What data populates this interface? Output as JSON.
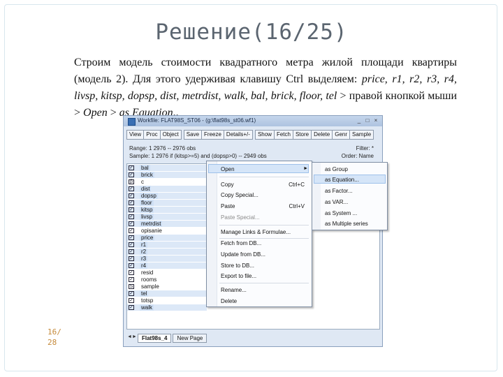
{
  "slide": {
    "title": "Решение(16/25)",
    "text_part1": "Строим модель стоимости квадратного метра жилой площади квартиры (модель 2). Для этого удерживая клавишу Ctrl выделяем: ",
    "text_italic1": "price, r1, r2, r3, r4, livsp, kitsp, dopsp, dist, metrdist, walk,  bal, brick, floor, tel",
    "text_part2": " > правой кнопкой мыши > ",
    "text_italic2": "Open",
    "text_part3": " > ",
    "text_italic3": "as Equation",
    "text_part4": "..",
    "page_number_top": "16/",
    "page_number_bottom": "28"
  },
  "window": {
    "title": "Workfile: FLAT98S_ST06 - (g:\\flat98s_st06.wf1)",
    "controls": [
      "_",
      "□",
      "×"
    ],
    "toolbar": [
      "View",
      "Proc",
      "Object",
      "Save",
      "Freeze",
      "Details+/-",
      "Show",
      "Fetch",
      "Store",
      "Delete",
      "Genr",
      "Sample"
    ],
    "range_text": "Range:  1 2976  --  2976 obs",
    "sample_text": "Sample: 1 2976 if (kitsp>=5) and (dopsp>0) -- 2949 obs",
    "filter_text": "Filter: *",
    "order_text": "Order: Name",
    "objects": [
      {
        "name": "bal",
        "icon": "check",
        "selected": true
      },
      {
        "name": "brick",
        "icon": "check",
        "selected": true
      },
      {
        "name": "c",
        "icon": "coef",
        "selected": false
      },
      {
        "name": "dist",
        "icon": "check",
        "selected": true
      },
      {
        "name": "dopsp",
        "icon": "check",
        "selected": true
      },
      {
        "name": "floor",
        "icon": "check",
        "selected": true
      },
      {
        "name": "kitsp",
        "icon": "check",
        "selected": true
      },
      {
        "name": "livsp",
        "icon": "check",
        "selected": true
      },
      {
        "name": "metrdist",
        "icon": "check",
        "selected": true
      },
      {
        "name": "opisanie",
        "icon": "check",
        "selected": false
      },
      {
        "name": "price",
        "icon": "check",
        "selected": true
      },
      {
        "name": "r1",
        "icon": "check",
        "selected": true
      },
      {
        "name": "r2",
        "icon": "check",
        "selected": true
      },
      {
        "name": "r3",
        "icon": "check",
        "selected": true
      },
      {
        "name": "r4",
        "icon": "check",
        "selected": true
      },
      {
        "name": "resid",
        "icon": "check",
        "selected": false
      },
      {
        "name": "rooms",
        "icon": "check",
        "selected": false
      },
      {
        "name": "sample",
        "icon": "sample",
        "selected": false
      },
      {
        "name": "tel",
        "icon": "check",
        "selected": true
      },
      {
        "name": "totsp",
        "icon": "check",
        "selected": false
      },
      {
        "name": "walk",
        "icon": "check",
        "selected": true
      }
    ],
    "tabs": [
      "Flat98s_4",
      "New Page"
    ],
    "nav_arrows": [
      "◄",
      "►"
    ]
  },
  "context_menu": {
    "open": "Open",
    "copy": "Copy",
    "copy_shortcut": "Ctrl+C",
    "copy_special": "Copy Special...",
    "paste": "Paste",
    "paste_shortcut": "Ctrl+V",
    "paste_special": "Paste Special...",
    "manage_links": "Manage Links & Formulae...",
    "fetch": "Fetch from DB...",
    "update": "Update from DB...",
    "store": "Store to DB...",
    "export": "Export to file...",
    "rename": "Rename...",
    "delete": "Delete"
  },
  "open_submenu": {
    "as_group": "as Group",
    "as_equation": "as Equation...",
    "as_factor": "as Factor...",
    "as_var": "as VAR...",
    "as_system": "as System ...",
    "as_multiple": "as Multiple series"
  }
}
